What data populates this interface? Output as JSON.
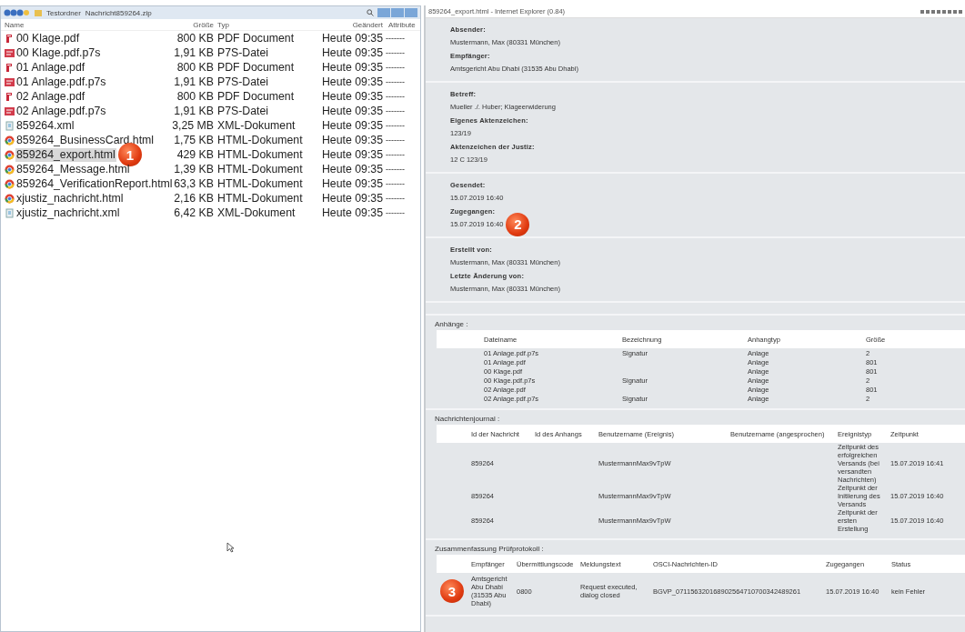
{
  "explorer": {
    "breadcrumb": [
      "Testordner",
      "Nachricht859264.zip"
    ],
    "columns": [
      "Name",
      "Größe",
      "Typ",
      "Geändert",
      "Attribute"
    ],
    "files": [
      {
        "kind": "pdf",
        "name": "00 Klage.pdf",
        "size": "800 KB",
        "type": "PDF Document",
        "modified": "Heute 09:35",
        "attributes": "-------",
        "selected": false
      },
      {
        "kind": "signature",
        "name": "00 Klage.pdf.p7s",
        "size": "1,91 KB",
        "type": "P7S-Datei",
        "modified": "Heute 09:35",
        "attributes": "-------",
        "selected": false
      },
      {
        "kind": "pdf",
        "name": "01 Anlage.pdf",
        "size": "800 KB",
        "type": "PDF Document",
        "modified": "Heute 09:35",
        "attributes": "-------",
        "selected": false
      },
      {
        "kind": "signature",
        "name": "01 Anlage.pdf.p7s",
        "size": "1,91 KB",
        "type": "P7S-Datei",
        "modified": "Heute 09:35",
        "attributes": "-------",
        "selected": false
      },
      {
        "kind": "pdf",
        "name": "02 Anlage.pdf",
        "size": "800 KB",
        "type": "PDF Document",
        "modified": "Heute 09:35",
        "attributes": "-------",
        "selected": false
      },
      {
        "kind": "signature",
        "name": "02 Anlage.pdf.p7s",
        "size": "1,91 KB",
        "type": "P7S-Datei",
        "modified": "Heute 09:35",
        "attributes": "-------",
        "selected": false
      },
      {
        "kind": "xml",
        "name": "859264.xml",
        "size": "3,25 MB",
        "type": "XML-Dokument",
        "modified": "Heute 09:35",
        "attributes": "-------",
        "selected": false
      },
      {
        "kind": "html",
        "name": "859264_BusinessCard.html",
        "size": "1,75 KB",
        "type": "HTML-Dokument",
        "modified": "Heute 09:35",
        "attributes": "-------",
        "selected": false
      },
      {
        "kind": "html",
        "name": "859264_export.html",
        "size": "429 KB",
        "type": "HTML-Dokument",
        "modified": "Heute 09:35",
        "attributes": "-------",
        "selected": true,
        "badge": "1"
      },
      {
        "kind": "html",
        "name": "859264_Message.html",
        "size": "1,39 KB",
        "type": "HTML-Dokument",
        "modified": "Heute 09:35",
        "attributes": "-------",
        "selected": false
      },
      {
        "kind": "html",
        "name": "859264_VerificationReport.html",
        "size": "63,3 KB",
        "type": "HTML-Dokument",
        "modified": "Heute 09:35",
        "attributes": "-------",
        "selected": false
      },
      {
        "kind": "html",
        "name": "xjustiz_nachricht.html",
        "size": "2,16 KB",
        "type": "HTML-Dokument",
        "modified": "Heute 09:35",
        "attributes": "-------",
        "selected": false
      },
      {
        "kind": "xml",
        "name": "xjustiz_nachricht.xml",
        "size": "6,42 KB",
        "type": "XML-Dokument",
        "modified": "Heute 09:35",
        "attributes": "-------",
        "selected": false
      }
    ]
  },
  "browser": {
    "title": "859264_export.html - Internet Explorer (0.84)",
    "sections": [
      {
        "fields": [
          {
            "label": "Absender:",
            "value": "Mustermann, Max (80331 München)"
          },
          {
            "label": "Empfänger:",
            "value": "Amtsgericht Abu Dhabi (31535 Abu Dhabi)"
          }
        ]
      },
      {
        "fields": [
          {
            "label": "Betreff:",
            "value": "Mueller ./. Huber; Klageerwiderung"
          },
          {
            "label": "Eigenes Aktenzeichen:",
            "value": "123/19"
          },
          {
            "label": "Aktenzeichen der Justiz:",
            "value": "12 C 123/19"
          }
        ]
      },
      {
        "fields": [
          {
            "label": "Gesendet:",
            "value": "15.07.2019 16:40"
          },
          {
            "label": "Zugegangen:",
            "value": "15.07.2019 16:40",
            "badge": "2"
          }
        ]
      },
      {
        "fields": [
          {
            "label": "Erstellt von:",
            "value": "Mustermann, Max (80331 München)"
          },
          {
            "label": "Letzte Änderung von:",
            "value": "Mustermann, Max (80331 München)"
          }
        ]
      }
    ],
    "tables": [
      {
        "kind": "attachments",
        "title": "Anhänge :",
        "columns": [
          "Dateiname",
          "Bezeichnung",
          "Anhangtyp",
          "Größe"
        ],
        "rows": [
          [
            "01 Anlage.pdf.p7s",
            "Signatur",
            "Anlage",
            "2"
          ],
          [
            "01 Anlage.pdf",
            "",
            "Anlage",
            "801"
          ],
          [
            "00 Klage.pdf",
            "",
            "Anlage",
            "801"
          ],
          [
            "00 Klage.pdf.p7s",
            "Signatur",
            "Anlage",
            "2"
          ],
          [
            "02 Anlage.pdf",
            "",
            "Anlage",
            "801"
          ],
          [
            "02 Anlage.pdf.p7s",
            "Signatur",
            "Anlage",
            "2"
          ]
        ]
      },
      {
        "kind": "journal",
        "title": "Nachrichtenjournal :",
        "columns": [
          "Id der Nachricht",
          "Id des Anhangs",
          "Benutzername (Ereignis)",
          "Benutzername (angesprochen)",
          "Ereignistyp",
          "Zeitpunkt"
        ],
        "rows": [
          [
            "859264",
            "",
            "MustermannMax9vTpW",
            "",
            "Zeitpunkt des erfolgreichen Versands (bei versandten Nachrichten)",
            "15.07.2019 16:41"
          ],
          [
            "859264",
            "",
            "MustermannMax9vTpW",
            "",
            "Zeitpunkt der Initiierung des Versands",
            "15.07.2019 16:40"
          ],
          [
            "859264",
            "",
            "MustermannMax9vTpW",
            "",
            "Zeitpunkt der ersten Erstellung",
            "15.07.2019 16:40"
          ]
        ]
      },
      {
        "kind": "verification",
        "title": "Zusammenfassung Prüfprotokoll :",
        "columns": [
          "Empfänger",
          "Übermittlungscode",
          "Meldungstext",
          "OSCI-Nachrichten-ID",
          "Zugegangen",
          "Status"
        ],
        "rows": [
          [
            "Amtsgericht Abu Dhabi (31535 Abu Dhabi)",
            "0800",
            "Request executed, dialog closed",
            "BGVP_071156320168902564710700342489261",
            "15.07.2019 16:40",
            "kein Fehler"
          ]
        ],
        "badge": "3"
      }
    ]
  }
}
